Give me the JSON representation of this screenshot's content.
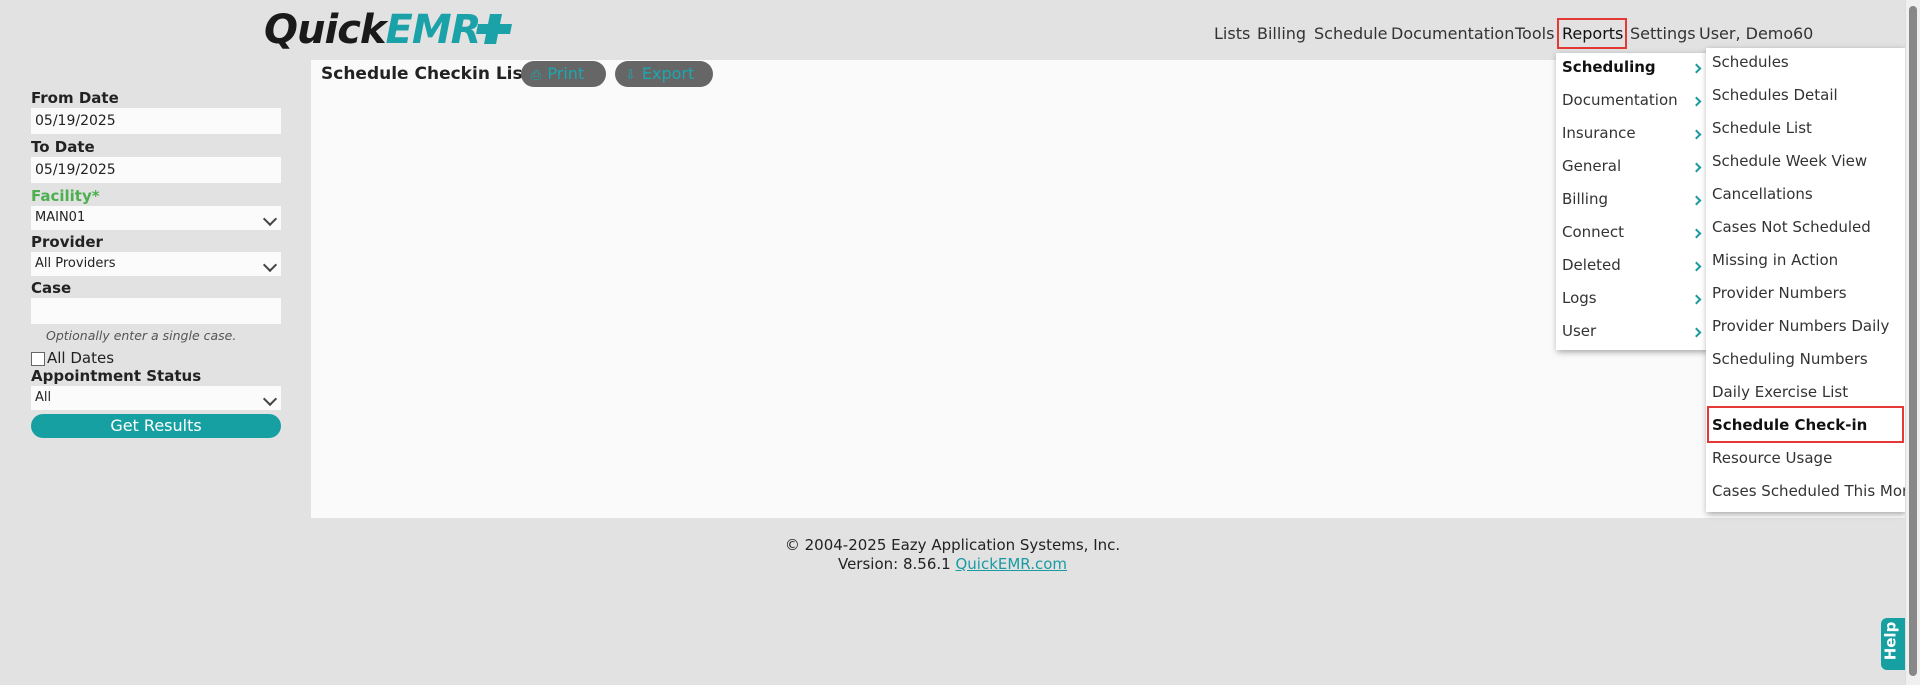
{
  "logo": {
    "part1": "Quick",
    "part2": "EMR"
  },
  "nav": {
    "items": [
      "Lists",
      "Billing",
      "Schedule",
      "Documentation",
      "Tools",
      "Reports",
      "Settings",
      "User, Demo",
      "60"
    ]
  },
  "sidebar": {
    "from_date_label": "From Date",
    "from_date_value": "05/19/2025",
    "to_date_label": "To Date",
    "to_date_value": "05/19/2025",
    "facility_label": "Facility*",
    "facility_value": "MAIN01",
    "provider_label": "Provider",
    "provider_value": "All Providers",
    "case_label": "Case",
    "case_value": "",
    "case_hint": "Optionally enter a single case.",
    "all_dates_label": "All Dates",
    "appt_status_label": "Appointment Status",
    "appt_status_value": "All",
    "get_results_label": "Get Results"
  },
  "content": {
    "title": "Schedule Checkin List",
    "print_label": "Print",
    "export_label": "Export"
  },
  "reports_menu": {
    "items": [
      "Scheduling",
      "Documentation",
      "Insurance",
      "General",
      "Billing",
      "Connect",
      "Deleted",
      "Logs",
      "User"
    ]
  },
  "scheduling_submenu": {
    "items": [
      "Schedules",
      "Schedules Detail",
      "Schedule List",
      "Schedule Week View",
      "Cancellations",
      "Cases Not Scheduled",
      "Missing in Action",
      "Provider Numbers",
      "Provider Numbers Daily",
      "Scheduling Numbers",
      "Daily Exercise List",
      "Schedule Check-in",
      "Resource Usage",
      "Cases Scheduled This Mont"
    ]
  },
  "footer": {
    "copyright": "© 2004-2025 Eazy Application Systems, Inc.",
    "version": "Version: 8.56.1",
    "link": "QuickEMR.com"
  },
  "help": {
    "label": "Help"
  },
  "colors": {
    "accent": "#17a0a1",
    "highlight": "#e53935",
    "green": "#4caf50"
  }
}
